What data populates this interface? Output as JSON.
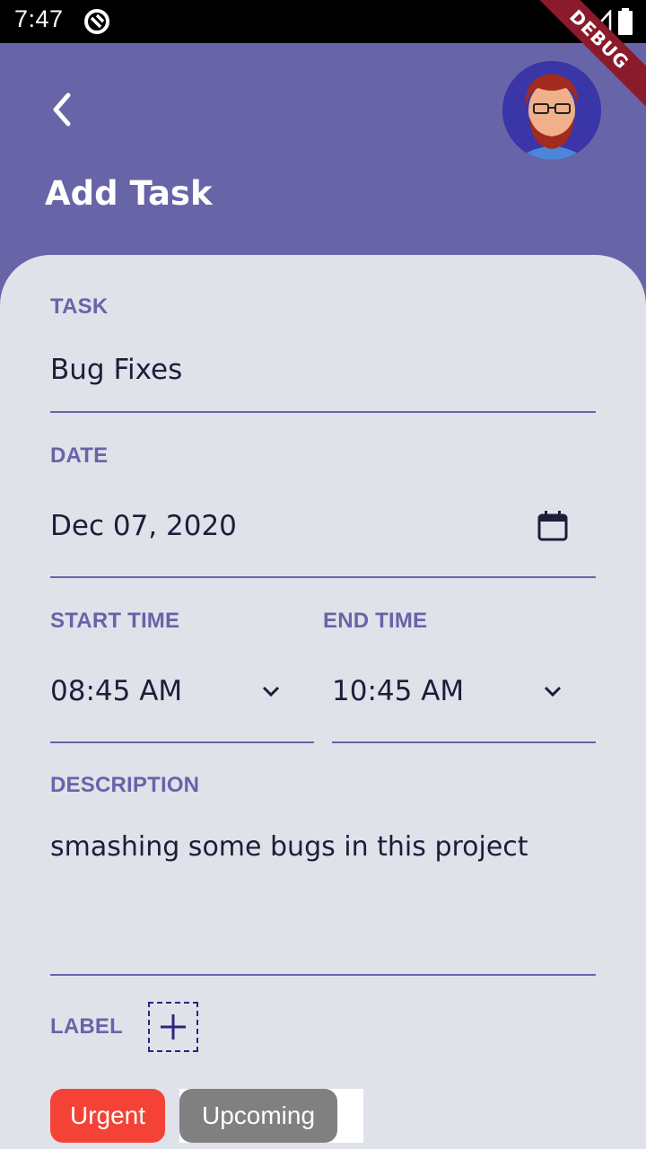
{
  "status_bar": {
    "time": "7:47",
    "debug_banner": "DEBUG"
  },
  "header": {
    "title": "Add Task",
    "back_icon": "chevron-left-icon",
    "avatar": "user-avatar"
  },
  "form": {
    "task": {
      "label": "TASK",
      "value": "Bug Fixes"
    },
    "date": {
      "label": "DATE",
      "value": "Dec 07, 2020",
      "icon": "calendar-icon"
    },
    "start_time": {
      "label": "START TIME",
      "value": "08:45 AM"
    },
    "end_time": {
      "label": "END TIME",
      "value": "10:45 AM"
    },
    "description": {
      "label": "DESCRIPTION",
      "value": "smashing some bugs in this project"
    },
    "label": {
      "label": "LABEL",
      "add_icon": "plus-icon"
    },
    "chips": [
      {
        "label": "Urgent",
        "color": "#F44336"
      },
      {
        "label": "Upcoming",
        "color": "#808080"
      }
    ]
  },
  "colors": {
    "primary": "#6764A8",
    "card_background": "#E0E2EA",
    "text_dark": "#1E1D3A"
  }
}
